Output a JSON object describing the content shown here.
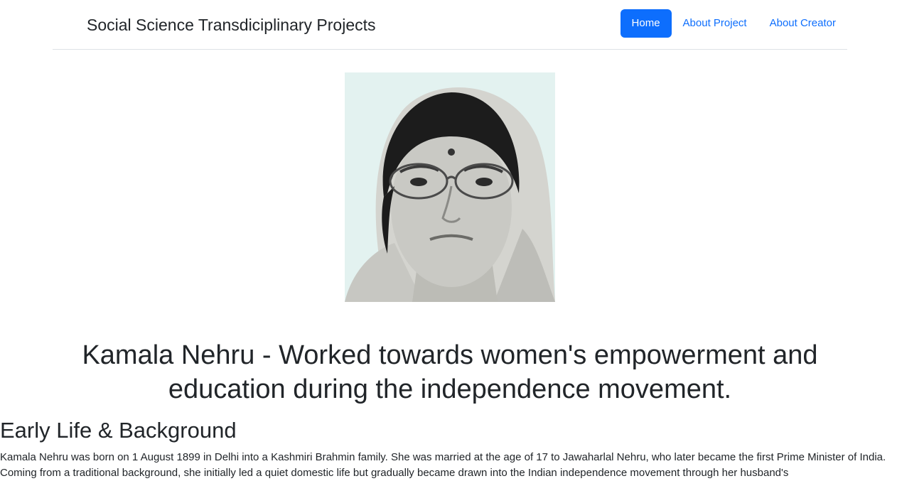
{
  "navbar": {
    "brand": "Social Science Transdiciplinary Projects",
    "links": [
      {
        "label": "Home",
        "active": true
      },
      {
        "label": "About Project",
        "active": false
      },
      {
        "label": "About Creator",
        "active": false
      }
    ]
  },
  "colors": {
    "accent": "#0d6efd",
    "text": "#212529",
    "divider": "#dee2e6",
    "portrait_bg": "#e3f2f0"
  },
  "main": {
    "portrait": {
      "subject": "portrait photo"
    },
    "headline": "Kamala Nehru - Worked towards women's empowerment and education during the independence movement.",
    "sections": [
      {
        "title": "Early Life & Background",
        "text": "Kamala Nehru was born on 1 August 1899 in Delhi into a Kashmiri Brahmin family. She was married at the age of 17 to Jawaharlal Nehru, who later became the first Prime Minister of India. Coming from a traditional background, she initially led a quiet domestic life but gradually became drawn into the Indian independence movement through her husband's"
      }
    ]
  }
}
